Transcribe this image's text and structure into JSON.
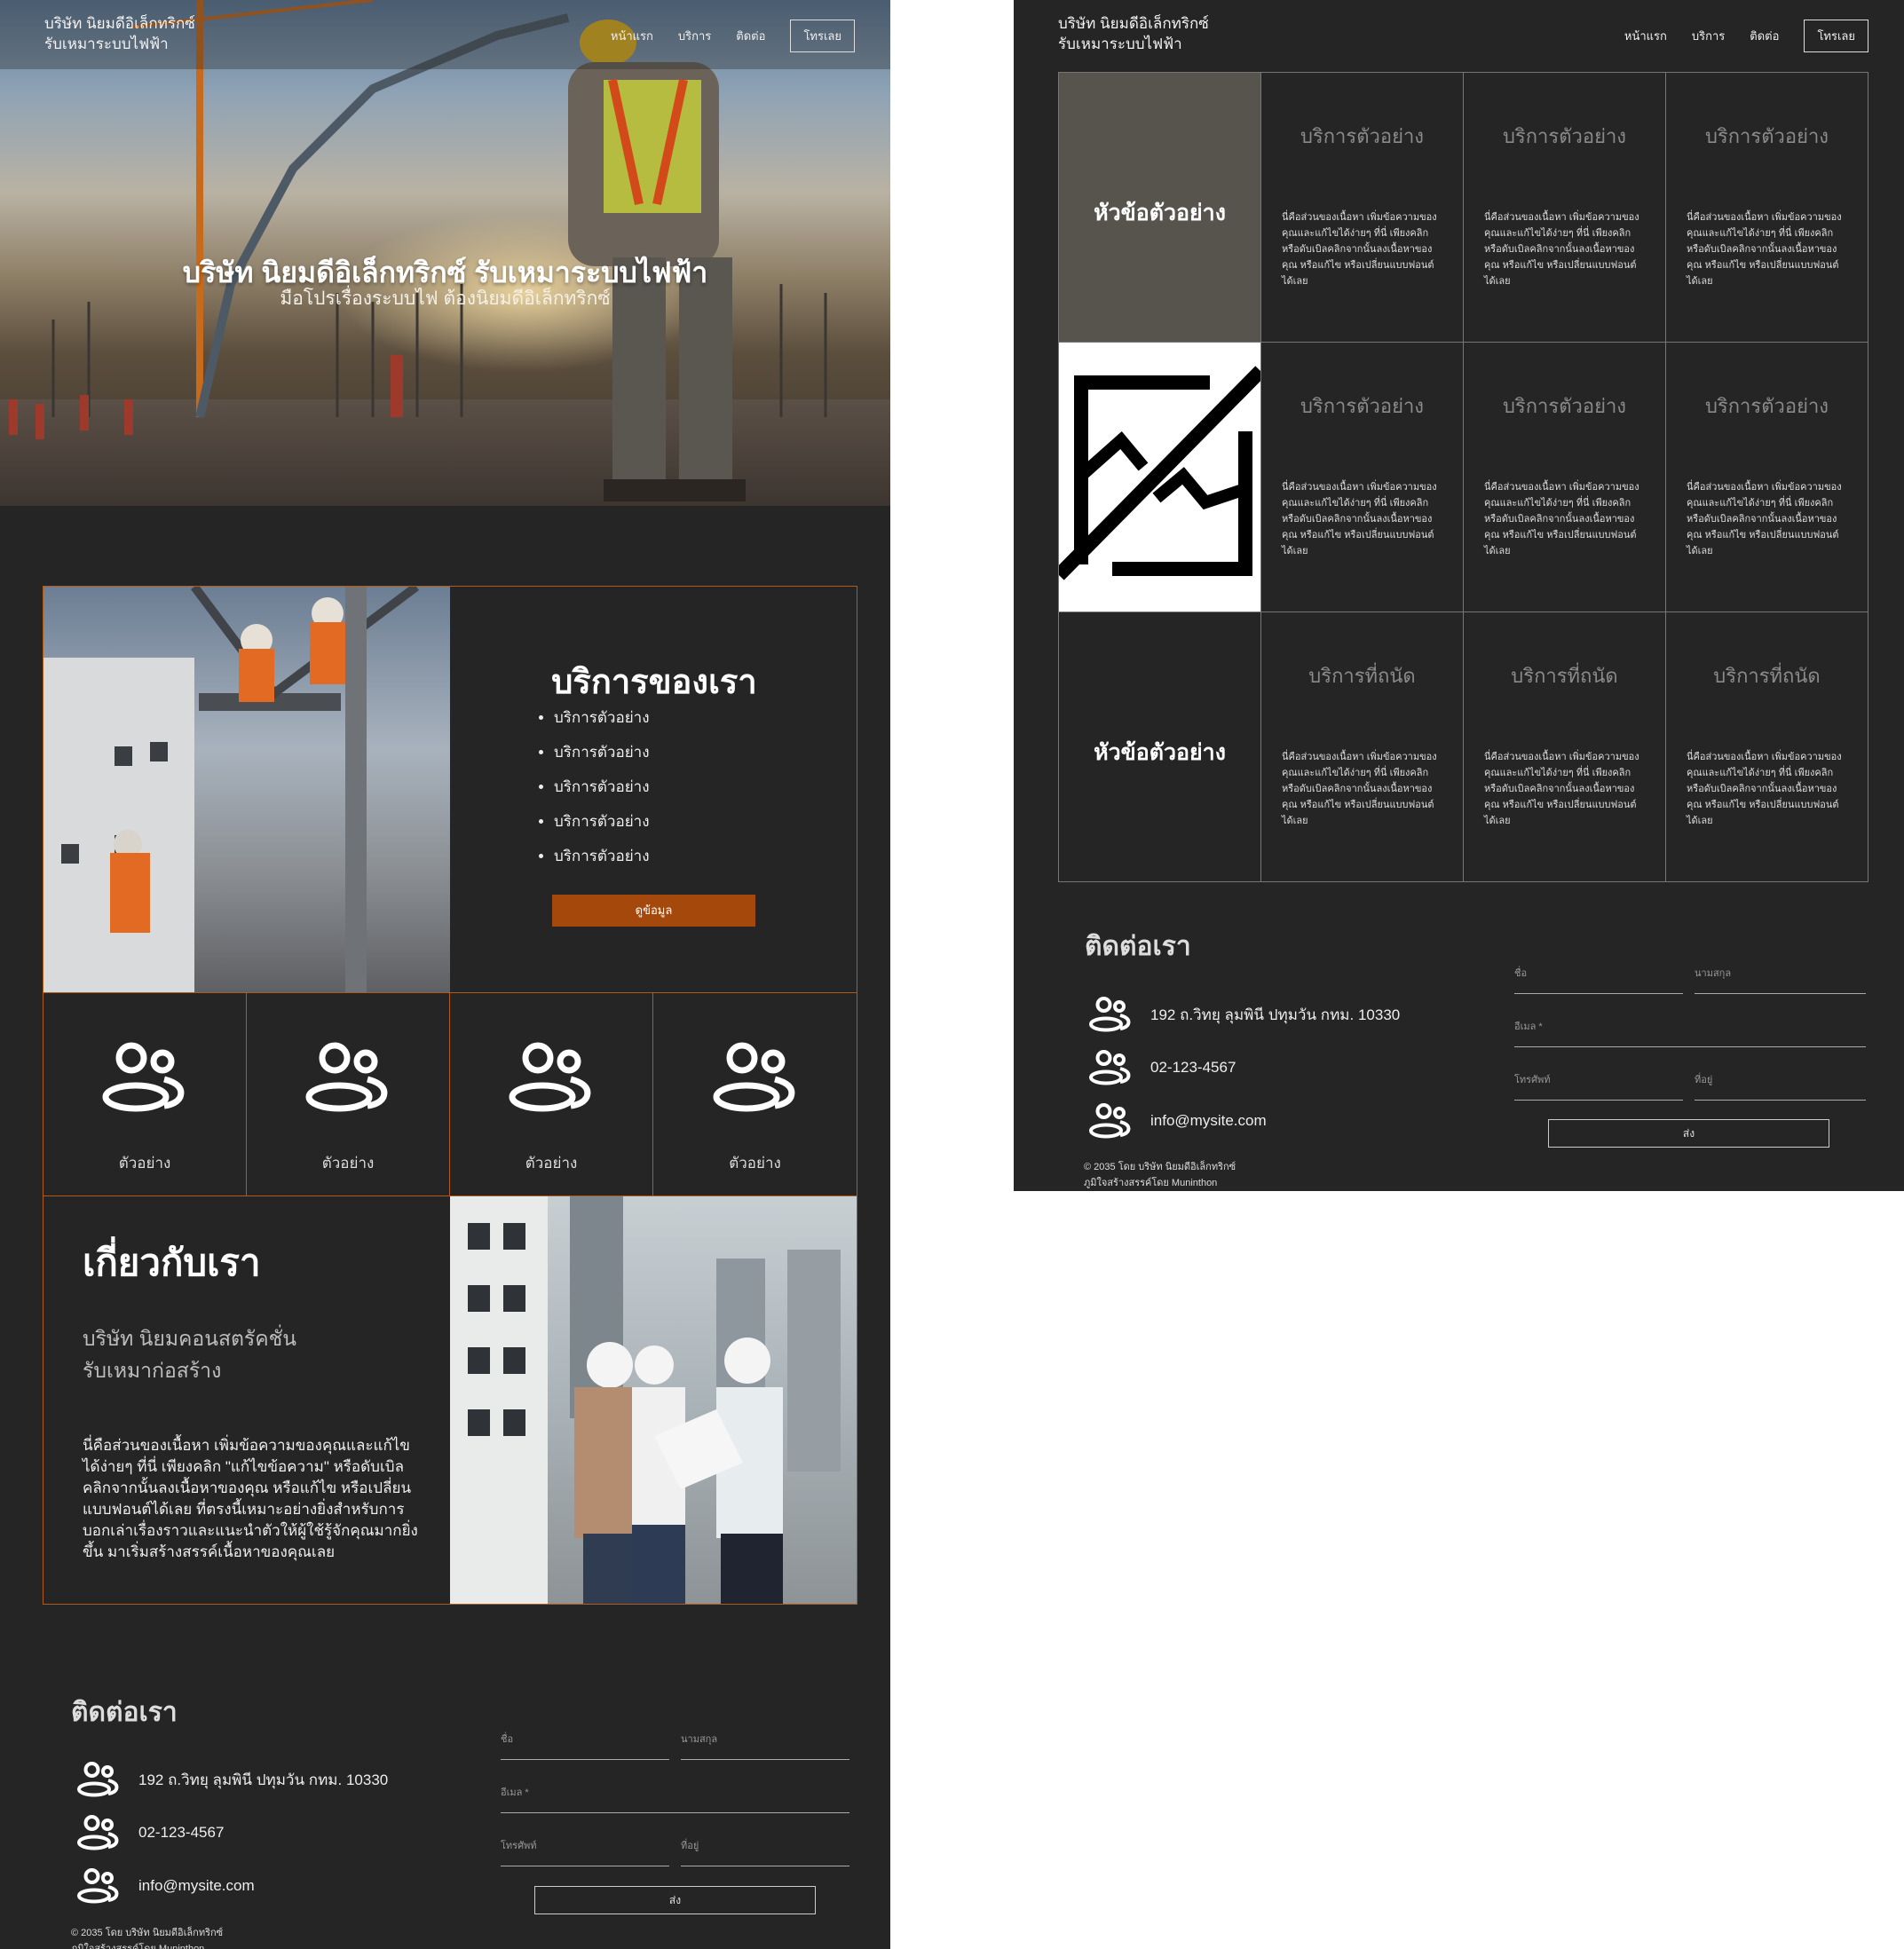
{
  "header": {
    "brand_line1": "บริษัท นิยมดีอิเล็กทริกซ์",
    "brand_line2": "รับเหมาระบบไฟฟ้า",
    "nav": [
      "หน้าแรก",
      "บริการ",
      "ติดต่อ"
    ],
    "cta": "โทรเลย"
  },
  "hero": {
    "title": "บริษัท นิยมดีอิเล็กทริกซ์ รับเหมาระบบไฟฟ้า",
    "subtitle": "มือโปรเรื่องระบบไฟ ต้องนิยมดีอิเล็กทริกซ์"
  },
  "services": {
    "title": "บริการของเรา",
    "items": [
      "บริการตัวอย่าง",
      "บริการตัวอย่าง",
      "บริการตัวอย่าง",
      "บริการตัวอย่าง",
      "บริการตัวอย่าง"
    ],
    "button": "ดูข้อมูล"
  },
  "features": [
    "ตัวอย่าง",
    "ตัวอย่าง",
    "ตัวอย่าง",
    "ตัวอย่าง"
  ],
  "about": {
    "title": "เกี่ยวกับเรา",
    "subtitle_line1": "บริษัท นิยมคอนสตรัคชั่น",
    "subtitle_line2": "รับเหมาก่อสร้าง",
    "body": "นี่คือส่วนของเนื้อหา เพิ่มข้อความของคุณและแก้ไขได้ง่ายๆ ที่นี่ เพียงคลิก \"แก้ไขข้อความ\" หรือดับเบิลคลิกจากนั้นลงเนื้อหาของคุณ หรือแก้ไข หรือเปลี่ยนแบบฟอนต์ได้เลย ที่ตรงนี้เหมาะอย่างยิ่งสำหรับการบอกเล่าเรื่องราวและแนะนำตัวให้ผู้ใช้รู้จักคุณมากยิ่งขึ้น มาเริ่มสร้างสรรค์เนื้อหาของคุณเลย"
  },
  "contact": {
    "title": "ติดต่อเรา",
    "address": "192 ถ.วิทยุ ลุมพินี ปทุมวัน กทม. 10330",
    "phone": "02-123-4567",
    "email": "info@mysite.com",
    "fields": {
      "first_name": "ชื่อ",
      "last_name": "นามสกุล",
      "email": "อีเมล *",
      "phone": "โทรศัพท์",
      "address": "ที่อยู่"
    },
    "send": "ส่ง"
  },
  "footer": {
    "line1": "© 2035 โดย บริษัท นิยมดีอิเล็กทริกซ์",
    "line2": "ภูมิใจสร้างสรรค์โดย Muninthon"
  },
  "grid": {
    "row_label": "หัวข้อตัวอย่าง",
    "service_head": "บริการตัวอย่าง",
    "featured_head": "บริการที่ถนัด",
    "body": "นี่คือส่วนของเนื้อหา เพิ่มข้อความของคุณและแก้ไขได้ง่ายๆ ที่นี่ เพียงคลิก หรือดับเบิลคลิกจากนั้นลงเนื้อหาของคุณ หรือแก้ไข หรือเปลี่ยนแบบฟอนต์ได้เลย"
  },
  "colors": {
    "background": "#262525",
    "accent": "#b25a18",
    "button": "#a4480c",
    "grid_highlight": "#57544d"
  }
}
